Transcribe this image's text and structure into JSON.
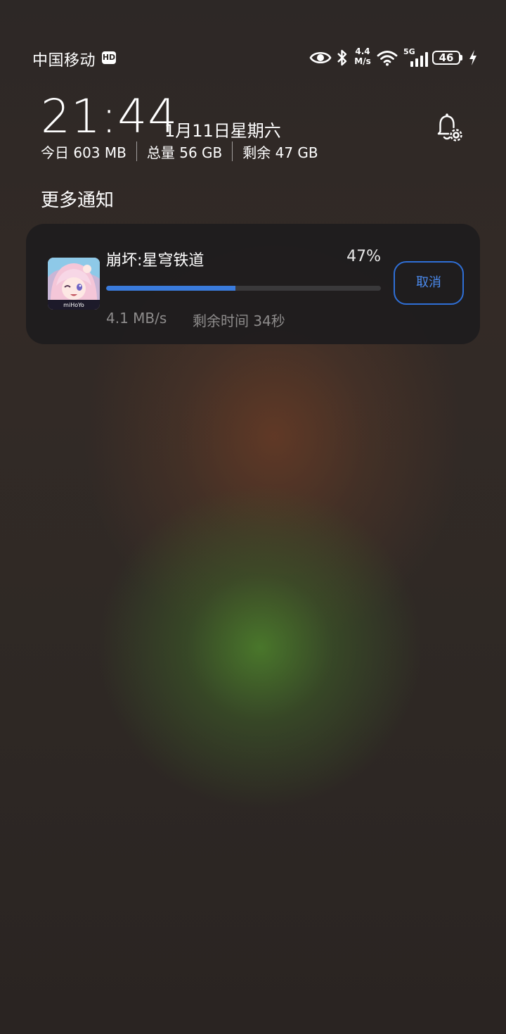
{
  "status_bar": {
    "carrier": "中国移动",
    "hd_badge": "HD",
    "net_speed_value": "4.4",
    "net_speed_unit": "M/s",
    "network_type": "5G",
    "battery_level": "46",
    "icons": [
      "eye-icon",
      "bluetooth-icon",
      "wifi-icon",
      "cellular-5g-icon",
      "battery-icon",
      "charging-bolt-icon"
    ]
  },
  "clock": {
    "time": "21:44",
    "date": "1月11日星期六"
  },
  "data_usage": {
    "today": "今日 603 MB",
    "total": "总量 56 GB",
    "remaining": "剩余 47 GB"
  },
  "header_icons": {
    "notification_settings": "bell-settings-icon"
  },
  "section": {
    "title": "更多通知"
  },
  "notification": {
    "app_name": "崩坏:星穹铁道",
    "progress_label": "47%",
    "progress_value": 0.47,
    "speed": "4.1 MB/s",
    "remaining_time": "剩余时间 34秒",
    "cancel_label": "取消",
    "app_icon": "game-app-icon",
    "accent_color": "#3a7bdc"
  }
}
